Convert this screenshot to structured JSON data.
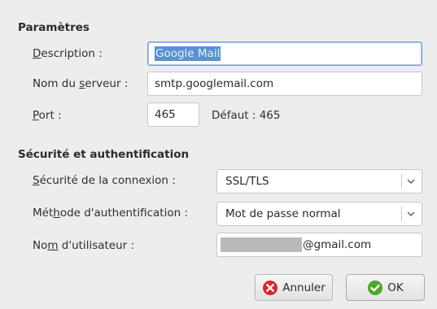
{
  "parameters": {
    "title": "Paramètres",
    "description": {
      "label_underlined": "D",
      "label_rest": "escription :",
      "value": "Google Mail"
    },
    "server": {
      "label_pre": "Nom du ",
      "label_underlined": "s",
      "label_post": "erveur :",
      "value": "smtp.googlemail.com"
    },
    "port": {
      "label_underlined": "P",
      "label_rest": "ort :",
      "value": "465",
      "default_text": "Défaut : 465"
    }
  },
  "security": {
    "title": "Sécurité et authentification",
    "connection": {
      "label_underlined": "S",
      "label_rest": "écurité de la connexion :",
      "value": "SSL/TLS"
    },
    "auth_method": {
      "label_pre": "Mét",
      "label_underlined": "h",
      "label_post": "ode d'authentification :",
      "value": "Mot de passe normal"
    },
    "username": {
      "label_pre": "No",
      "label_underlined": "m",
      "label_post": " d'utilisateur :",
      "value_suffix": "@gmail.com"
    }
  },
  "buttons": {
    "cancel": "Annuler",
    "ok": "OK"
  },
  "colors": {
    "cancel_icon": "#d42a2a",
    "ok_icon": "#4ea72c",
    "selection": "#5a91d3"
  }
}
